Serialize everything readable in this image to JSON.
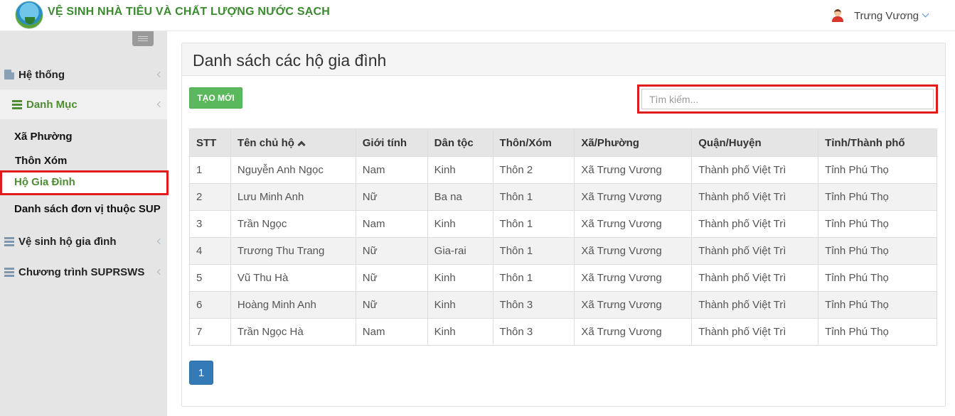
{
  "header": {
    "app_title": "VỆ SINH NHÀ TIÊU VÀ CHẤT LƯỢNG NƯỚC SẠCH",
    "user_name": "Trưng Vương"
  },
  "sidebar": {
    "categories": [
      {
        "label": "Hệ thống",
        "icon": "document-icon"
      },
      {
        "label": "Danh Mục",
        "icon": "list-icon"
      },
      {
        "label": "Vệ sinh hộ gia đình",
        "icon": "server-icon"
      },
      {
        "label": "Chương trình SUPRSWS",
        "icon": "server-icon"
      }
    ],
    "sub_items": [
      "Xã Phường",
      "Thôn Xóm",
      "Hộ Gia Đình",
      "Danh sách đơn vị thuộc SUP"
    ]
  },
  "main": {
    "title": "Danh sách các hộ gia đình",
    "new_button": "TẠO MỚI",
    "search_placeholder": "Tìm kiếm...",
    "columns": [
      "STT",
      "Tên chủ hộ",
      "Giới tính",
      "Dân tộc",
      "Thôn/Xóm",
      "Xã/Phường",
      "Quận/Huyện",
      "Tỉnh/Thành phố"
    ],
    "rows": [
      [
        "1",
        "Nguyễn Anh Ngọc",
        "Nam",
        "Kinh",
        "Thôn 2",
        "Xã Trưng Vương",
        "Thành phố Việt Trì",
        "Tỉnh Phú Thọ"
      ],
      [
        "2",
        "Lưu Minh Anh",
        "Nữ",
        "Ba na",
        "Thôn 1",
        "Xã Trưng Vương",
        "Thành phố Việt Trì",
        "Tỉnh Phú Thọ"
      ],
      [
        "3",
        "Trần Ngọc",
        "Nam",
        "Kinh",
        "Thôn 1",
        "Xã Trưng Vương",
        "Thành phố Việt Trì",
        "Tỉnh Phú Thọ"
      ],
      [
        "4",
        "Trương Thu Trang",
        "Nữ",
        "Gia-rai",
        "Thôn 1",
        "Xã Trưng Vương",
        "Thành phố Việt Trì",
        "Tỉnh Phú Thọ"
      ],
      [
        "5",
        "Vũ Thu Hà",
        "Nữ",
        "Kinh",
        "Thôn 1",
        "Xã Trưng Vương",
        "Thành phố Việt Trì",
        "Tỉnh Phú Thọ"
      ],
      [
        "6",
        "Hoàng Minh Anh",
        "Nữ",
        "Kinh",
        "Thôn 3",
        "Xã Trưng Vương",
        "Thành phố Việt Trì",
        "Tỉnh Phú Thọ"
      ],
      [
        "7",
        "Trần Ngọc Hà",
        "Nam",
        "Kinh",
        "Thôn 3",
        "Xã Trưng Vương",
        "Thành phố Việt Trì",
        "Tỉnh Phú Thọ"
      ]
    ],
    "pagination": {
      "current_page": "1"
    }
  },
  "colors": {
    "brand_green": "#4e8d34",
    "button_green": "#5cb85c",
    "pager_blue": "#337ab7",
    "highlight_red": "#e01b1b"
  }
}
